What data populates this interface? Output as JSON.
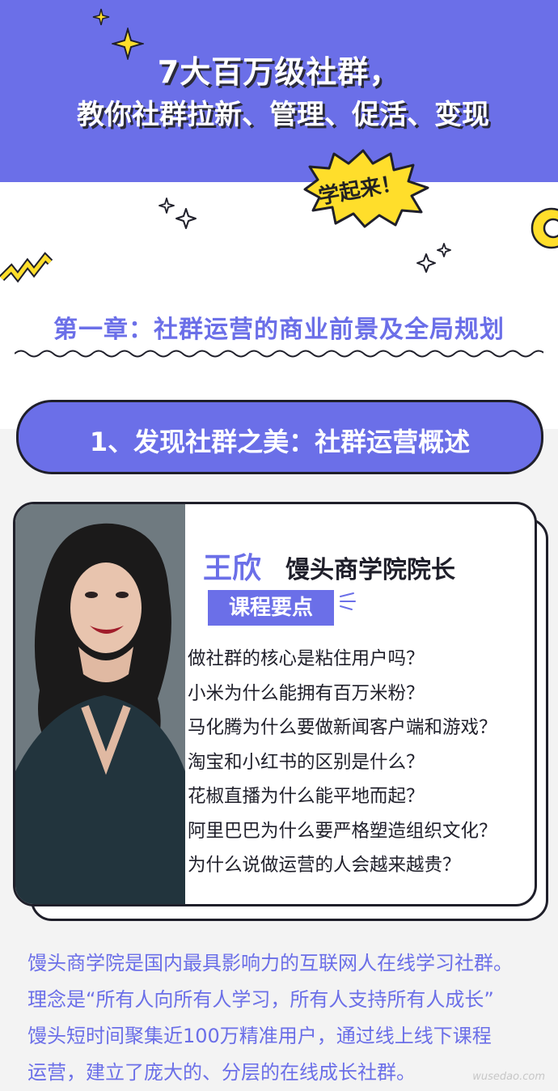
{
  "hero": {
    "title_line1": "7大百万级社群，",
    "title_line2": "教你社群拉新、管理、促活、变现",
    "badge": "学起来！"
  },
  "chapter": {
    "title": "第一章：社群运营的商业前景及全局规划"
  },
  "lesson": {
    "title": "1、发现社群之美：社群运营概述"
  },
  "teacher": {
    "name": "王欣",
    "role": "馒头商学院院长",
    "tag": "课程要点",
    "points": [
      "做社群的核心是粘住用户吗？",
      "小米为什么能拥有百万米粉？",
      "马化腾为什么要做新闻客户端和游戏？",
      "淘宝和小红书的区别是什么？",
      "花椒直播为什么能平地而起？",
      "阿里巴巴为什么要严格塑造组织文化？",
      "为什么说做运营的人会越来越贵？"
    ]
  },
  "intro": {
    "lines": [
      "馒头商学院是国内最具影响力的互联网人在线学习社群。",
      "理念是“所有人向所有人学习，所有人支持所有人成长”",
      "馒头短时间聚集近100万精准用户，通过线上线下课程",
      "运营，建立了庞大的、分层的在线成长社群。"
    ]
  },
  "watermark": "wusedao.com",
  "colors": {
    "accent": "#6b6fe8",
    "yellow": "#ffde2b",
    "ink": "#1f1f2a"
  }
}
